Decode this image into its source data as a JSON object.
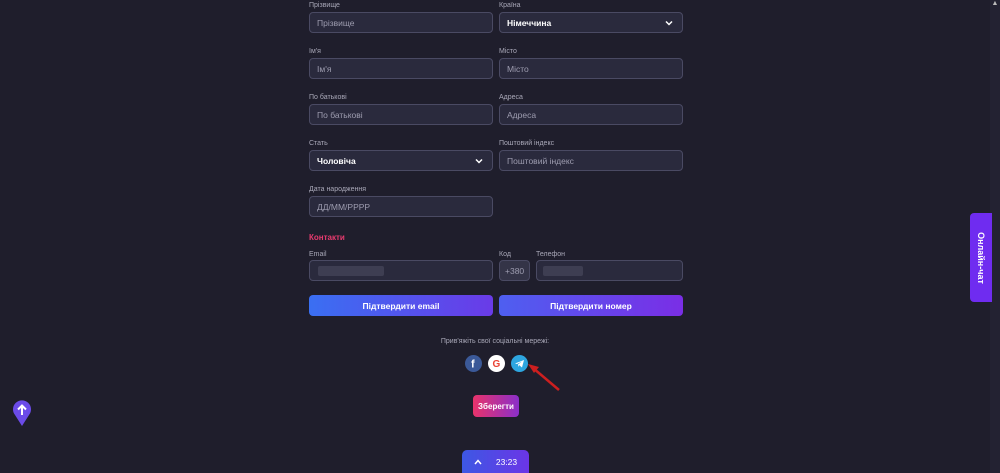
{
  "form": {
    "surname": {
      "label": "Прізвище",
      "placeholder": "Прізвище"
    },
    "country": {
      "label": "Країна",
      "value": "Німеччина"
    },
    "first_name": {
      "label": "Ім'я",
      "placeholder": "Ім'я"
    },
    "city": {
      "label": "Місто",
      "placeholder": "Місто"
    },
    "patronymic": {
      "label": "По батькові",
      "placeholder": "По батькові"
    },
    "address": {
      "label": "Адреса",
      "placeholder": "Адреса"
    },
    "gender": {
      "label": "Стать",
      "value": "Чоловіча"
    },
    "postal": {
      "label": "Поштовий індекс",
      "placeholder": "Поштовий індекс"
    },
    "birth_date": {
      "label": "Дата народження",
      "placeholder": "ДД/ММ/РРРР"
    }
  },
  "contacts": {
    "title": "Контакти",
    "email_label": "Email",
    "code_label": "Код",
    "code_value": "+380",
    "phone_label": "Телефон",
    "confirm_email": "Підтвердити email",
    "confirm_phone": "Підтвердити номер"
  },
  "social": {
    "caption": "Прив'яжіть свої соціальні мережі:",
    "networks": [
      "facebook-icon",
      "google-icon",
      "telegram-icon"
    ]
  },
  "save_label": "Зберегти",
  "chat_label": "Онлайн-чат",
  "timer": {
    "time": "23:23"
  },
  "colors": {
    "accent_pink": "#e83b6f",
    "chat_purple": "#6f2cf0",
    "background": "#1f1e2c"
  }
}
